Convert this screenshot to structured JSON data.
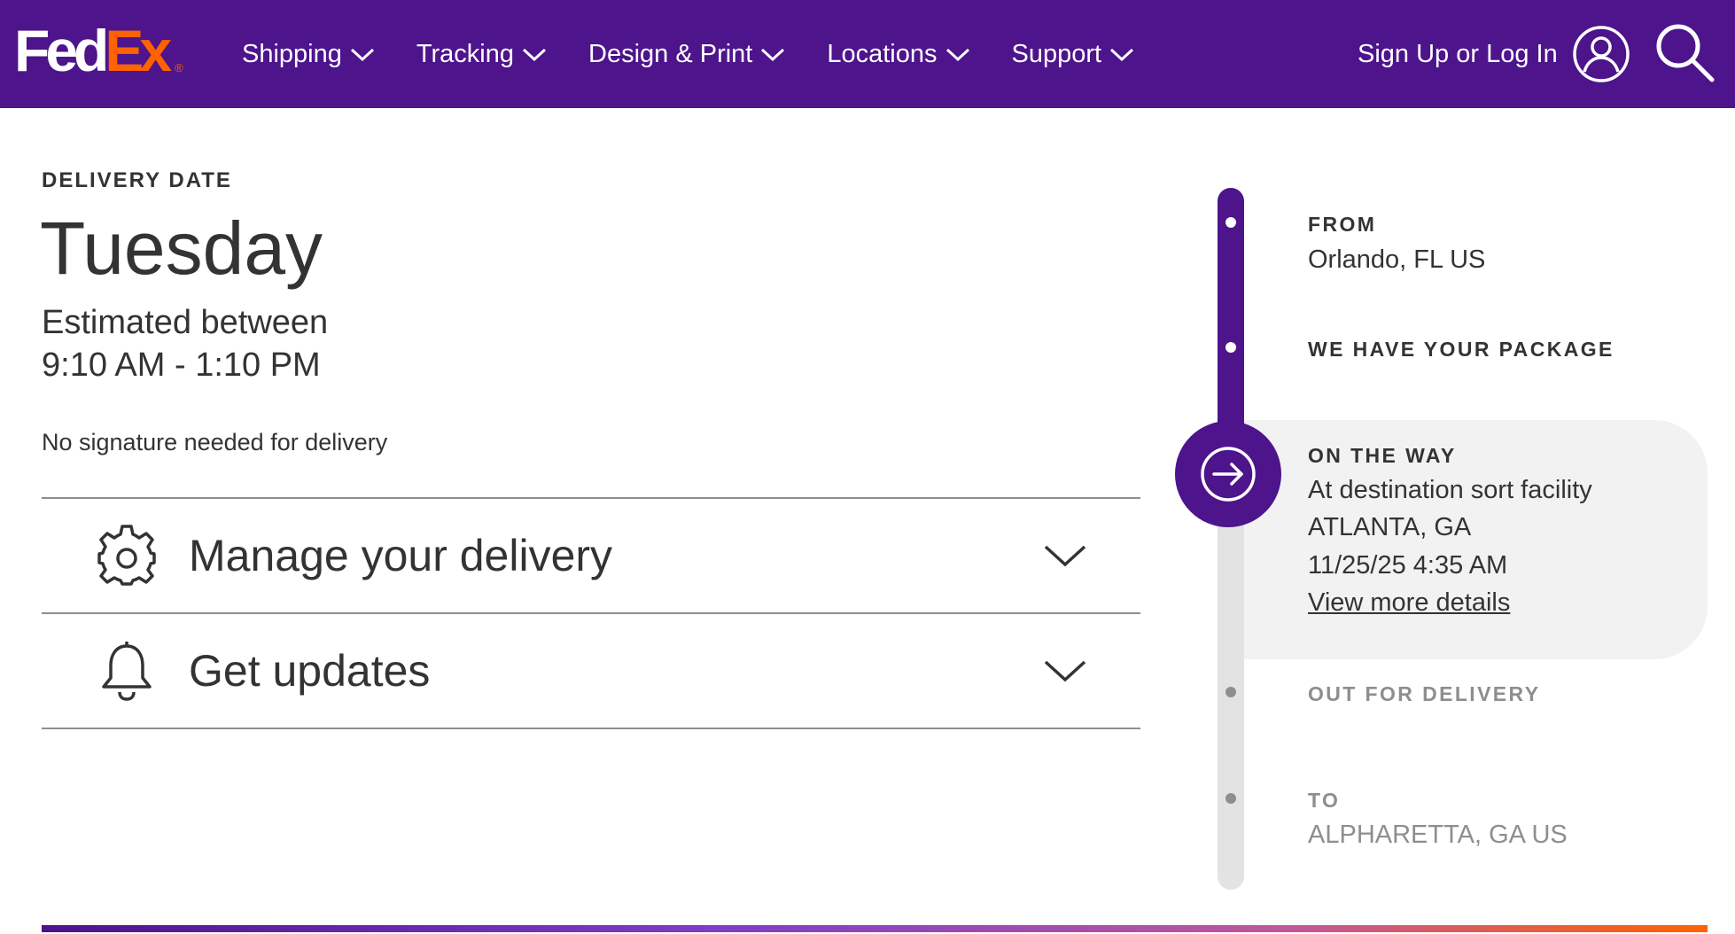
{
  "colors": {
    "brand_purple": "#4d148c",
    "brand_orange": "#ff6200",
    "text_dark": "#333333",
    "text_muted": "#8e8e8e",
    "panel_bg": "#f2f2f2"
  },
  "header": {
    "logo": {
      "part1": "Fed",
      "part2": "Ex",
      "mark": "®"
    },
    "nav": [
      {
        "label": "Shipping",
        "icon": "chevron-down-icon"
      },
      {
        "label": "Tracking",
        "icon": "chevron-down-icon"
      },
      {
        "label": "Design & Print",
        "icon": "chevron-down-icon"
      },
      {
        "label": "Locations",
        "icon": "chevron-down-icon"
      },
      {
        "label": "Support",
        "icon": "chevron-down-icon"
      }
    ],
    "login_label": "Sign Up or Log In",
    "login_icon": "user-icon",
    "search_icon": "search-icon"
  },
  "delivery": {
    "label": "DELIVERY DATE",
    "day": "Tuesday",
    "estimated_line1": "Estimated between",
    "estimated_line2": "9:10 AM - 1:10 PM",
    "signature_note": "No signature needed for delivery"
  },
  "accordions": [
    {
      "label": "Manage your delivery",
      "icon": "gear-icon"
    },
    {
      "label": "Get updates",
      "icon": "bell-icon"
    }
  ],
  "timeline": {
    "from": {
      "heading": "FROM",
      "location": "Orlando, FL US"
    },
    "received": {
      "heading": "WE HAVE YOUR PACKAGE"
    },
    "current": {
      "heading": "ON THE WAY",
      "status": "At destination sort facility",
      "location": "ATLANTA, GA",
      "datetime": "11/25/25 4:35 AM",
      "link": "View more details",
      "icon": "arrow-right-circle-icon"
    },
    "out_for_delivery": {
      "heading": "OUT FOR DELIVERY"
    },
    "to": {
      "heading": "TO",
      "location": "ALPHARETTA, GA US"
    }
  }
}
